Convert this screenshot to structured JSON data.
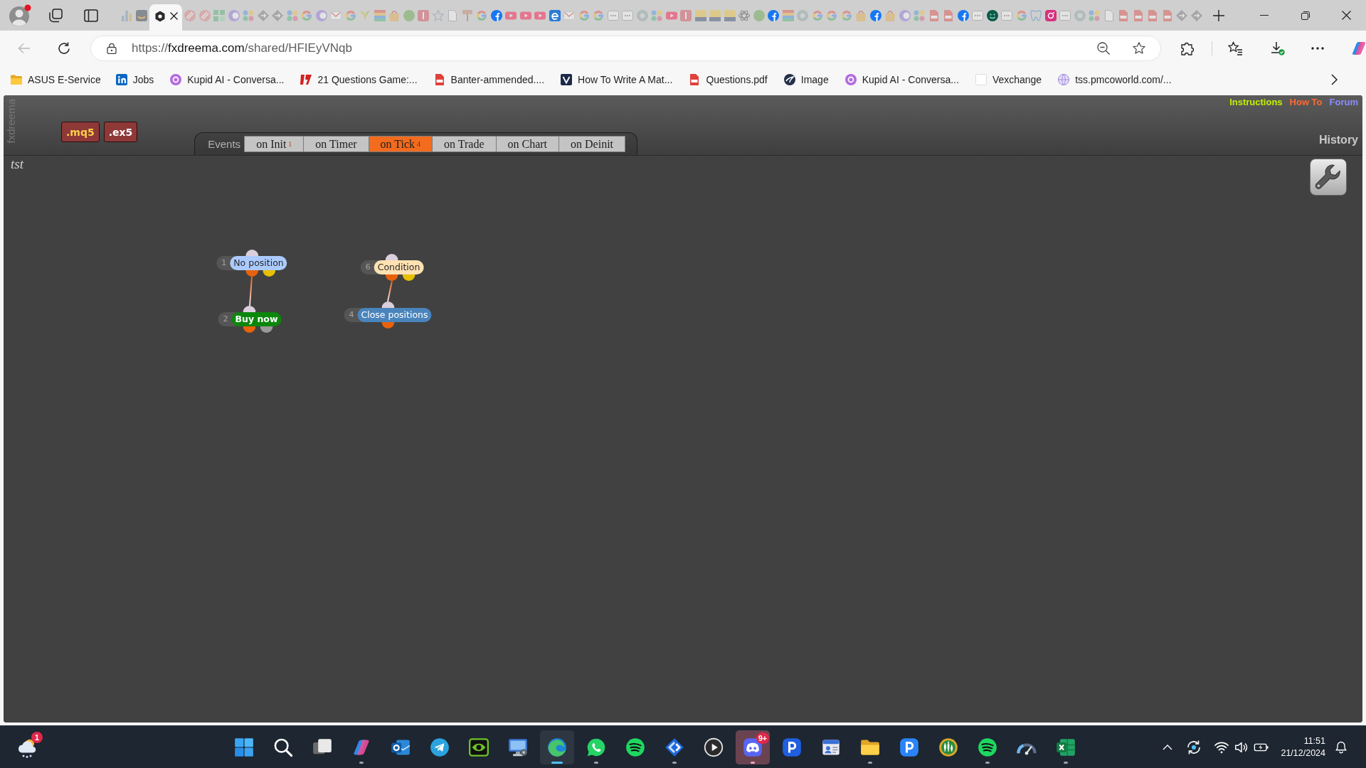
{
  "browser": {
    "tabs": [
      {
        "kind": "chart",
        "selected": false,
        "asleep": true
      },
      {
        "kind": "smile",
        "selected": false,
        "asleep": true
      },
      {
        "kind": "hexagon",
        "selected": true,
        "asleep": false
      },
      {
        "kind": "slash",
        "selected": false,
        "asleep": true
      },
      {
        "kind": "slash",
        "selected": false,
        "asleep": true
      },
      {
        "kind": "grid",
        "selected": false,
        "asleep": true
      },
      {
        "kind": "crescent",
        "selected": false,
        "asleep": true
      },
      {
        "kind": "dots",
        "selected": false,
        "asleep": true
      },
      {
        "kind": "diamond",
        "selected": false,
        "asleep": true
      },
      {
        "kind": "diamond",
        "selected": false,
        "asleep": true
      },
      {
        "kind": "dots",
        "selected": false,
        "asleep": true
      },
      {
        "kind": "ring",
        "selected": false,
        "asleep": true
      },
      {
        "kind": "crescent",
        "selected": false,
        "asleep": true
      },
      {
        "kind": "envelope",
        "selected": false,
        "asleep": true
      },
      {
        "kind": "ring",
        "selected": false,
        "asleep": true
      },
      {
        "kind": "leaf",
        "selected": false,
        "asleep": true
      },
      {
        "kind": "stripes",
        "selected": false,
        "asleep": true
      },
      {
        "kind": "bag",
        "selected": false,
        "asleep": true
      },
      {
        "kind": "disc",
        "selected": false,
        "asleep": true
      },
      {
        "kind": "tile",
        "selected": false,
        "asleep": true
      },
      {
        "kind": "star",
        "selected": false,
        "asleep": true
      },
      {
        "kind": "page",
        "selected": false,
        "asleep": true
      },
      {
        "kind": "sign",
        "selected": false,
        "asleep": true
      },
      {
        "kind": "ring",
        "selected": false,
        "asleep": true
      },
      {
        "kind": "fb",
        "selected": false,
        "asleep": false
      },
      {
        "kind": "play",
        "selected": false,
        "asleep": true
      },
      {
        "kind": "play",
        "selected": false,
        "asleep": true
      },
      {
        "kind": "play",
        "selected": false,
        "asleep": true
      },
      {
        "kind": "swirl",
        "selected": false,
        "asleep": false
      },
      {
        "kind": "envelope",
        "selected": false,
        "asleep": true
      },
      {
        "kind": "ring",
        "selected": false,
        "asleep": true
      },
      {
        "kind": "ring",
        "selected": false,
        "asleep": true
      },
      {
        "kind": "window",
        "selected": false,
        "asleep": true
      },
      {
        "kind": "window",
        "selected": false,
        "asleep": true
      },
      {
        "kind": "circle",
        "selected": false,
        "asleep": true
      },
      {
        "kind": "dots",
        "selected": false,
        "asleep": true
      },
      {
        "kind": "play",
        "selected": false,
        "asleep": true
      },
      {
        "kind": "tile",
        "selected": false,
        "asleep": true
      },
      {
        "kind": "crest",
        "selected": false,
        "asleep": true
      },
      {
        "kind": "crest",
        "selected": false,
        "asleep": true
      },
      {
        "kind": "crest",
        "selected": false,
        "asleep": true
      },
      {
        "kind": "knot",
        "selected": false,
        "asleep": true
      },
      {
        "kind": "disc",
        "selected": false,
        "asleep": true
      },
      {
        "kind": "fb",
        "selected": false,
        "asleep": false
      },
      {
        "kind": "stripes",
        "selected": false,
        "asleep": true
      },
      {
        "kind": "circle",
        "selected": false,
        "asleep": true
      },
      {
        "kind": "ring",
        "selected": false,
        "asleep": true
      },
      {
        "kind": "ring",
        "selected": false,
        "asleep": true
      },
      {
        "kind": "ring",
        "selected": false,
        "asleep": true
      },
      {
        "kind": "bag",
        "selected": false,
        "asleep": true
      },
      {
        "kind": "fb",
        "selected": false,
        "asleep": false
      },
      {
        "kind": "bag",
        "selected": false,
        "asleep": true
      },
      {
        "kind": "crescent",
        "selected": false,
        "asleep": true
      },
      {
        "kind": "dots",
        "selected": false,
        "asleep": true
      },
      {
        "kind": "pdf",
        "selected": false,
        "asleep": true
      },
      {
        "kind": "pdf",
        "selected": false,
        "asleep": true
      },
      {
        "kind": "fb",
        "selected": false,
        "asleep": false
      },
      {
        "kind": "window",
        "selected": false,
        "asleep": true
      },
      {
        "kind": "face",
        "selected": false,
        "asleep": false
      },
      {
        "kind": "window",
        "selected": false,
        "asleep": true
      },
      {
        "kind": "ring",
        "selected": false,
        "asleep": true
      },
      {
        "kind": "tooth",
        "selected": false,
        "asleep": true
      },
      {
        "kind": "camera",
        "selected": false,
        "asleep": false
      },
      {
        "kind": "window",
        "selected": false,
        "asleep": true
      },
      {
        "kind": "circle",
        "selected": false,
        "asleep": true
      },
      {
        "kind": "dots",
        "selected": false,
        "asleep": true
      },
      {
        "kind": "page",
        "selected": false,
        "asleep": true
      },
      {
        "kind": "pdf",
        "selected": false,
        "asleep": true
      },
      {
        "kind": "pdf",
        "selected": false,
        "asleep": true
      },
      {
        "kind": "pdf",
        "selected": false,
        "asleep": true
      },
      {
        "kind": "pdf",
        "selected": false,
        "asleep": true
      },
      {
        "kind": "diamond",
        "selected": false,
        "asleep": true
      },
      {
        "kind": "diamond",
        "selected": false,
        "asleep": true
      }
    ],
    "back_button": {
      "disabled": true
    },
    "address": {
      "scheme": "https://",
      "host": "fxdreema.com",
      "path": "/shared/HFIEyVNqb"
    },
    "bookmarks": [
      {
        "kind": "folder",
        "label": "ASUS E-Service"
      },
      {
        "kind": "blue_tile",
        "label": "Jobs"
      },
      {
        "kind": "purple_disc",
        "label": "Kupid AI - Conversa..."
      },
      {
        "kind": "red_mark",
        "label": "21 Questions Game:..."
      },
      {
        "kind": "pdf",
        "label": "Banter-ammended...."
      },
      {
        "kind": "dark_tile",
        "label": "How To Write A Mat..."
      },
      {
        "kind": "pdf",
        "label": "Questions.pdf"
      },
      {
        "kind": "dark_disc",
        "label": "Image"
      },
      {
        "kind": "purple_disc",
        "label": "Kupid AI - Conversa..."
      },
      {
        "kind": "blank",
        "label": "Vexchange"
      },
      {
        "kind": "globe",
        "label": "tss.pmcoworld.com/..."
      }
    ]
  },
  "app": {
    "side_label": "fxdreema",
    "exports": [
      {
        "label": ".mq5",
        "kind": "source"
      },
      {
        "label": ".ex5",
        "kind": "compiled"
      }
    ],
    "events_label": "Events",
    "event_tabs": [
      {
        "label": "on Init",
        "count": "1",
        "selected": false
      },
      {
        "label": "on Timer",
        "selected": false
      },
      {
        "label": "on Tick",
        "count": "4",
        "selected": true
      },
      {
        "label": "on Trade",
        "selected": false
      },
      {
        "label": "on Chart",
        "selected": false
      },
      {
        "label": "on Deinit",
        "selected": false
      }
    ],
    "links": [
      {
        "label": "Instructions",
        "color": "#c2f000"
      },
      {
        "label": "How To",
        "color": "#ff6a30"
      },
      {
        "label": "Forum",
        "color": "#8c8cff"
      }
    ],
    "history": "History",
    "project": "tst",
    "nodes": [
      {
        "number": "1",
        "label": "No position",
        "color": "#abcbff",
        "bold": false,
        "outputs": [
          {
            "color": "#e8610c",
            "children": [
              {
                "number": "2",
                "label": "Buy now",
                "color": "#0b870b",
                "bold": true,
                "outputs": [
                  {
                    "color": "#e8610c"
                  },
                  {
                    "color": "#9a9a9a"
                  }
                ]
              }
            ]
          },
          {
            "color": "#e6c000"
          }
        ]
      },
      {
        "number": "6",
        "label": "Condition",
        "color": "#ffe1b2",
        "bold": false,
        "outputs": [
          {
            "color": "#e8610c",
            "children": [
              {
                "number": "4",
                "label": "Close positions",
                "color": "#4a84bc",
                "bold": false,
                "outputs": [
                  {
                    "color": "#e8610c"
                  }
                ]
              }
            ]
          },
          {
            "color": "#e6c000"
          }
        ]
      }
    ]
  },
  "taskbar": {
    "weather_badge": "1",
    "apps": [
      {
        "kind": "start",
        "running": false,
        "selected": false,
        "flashing": false
      },
      {
        "kind": "search",
        "running": false,
        "selected": false,
        "flashing": false
      },
      {
        "kind": "taskview",
        "running": false,
        "selected": false,
        "flashing": false
      },
      {
        "kind": "copilot",
        "running": true,
        "selected": false,
        "flashing": false
      },
      {
        "kind": "outlook",
        "running": false,
        "selected": false,
        "flashing": false
      },
      {
        "kind": "telegram",
        "running": false,
        "selected": false,
        "flashing": false
      },
      {
        "kind": "eye",
        "running": false,
        "selected": false,
        "flashing": false
      },
      {
        "kind": "monitor",
        "running": false,
        "selected": false,
        "flashing": false
      },
      {
        "kind": "edge",
        "running": true,
        "selected": true,
        "flashing": false
      },
      {
        "kind": "whatsapp",
        "running": true,
        "selected": false,
        "flashing": false
      },
      {
        "kind": "spotify",
        "running": false,
        "selected": false,
        "flashing": false
      },
      {
        "kind": "diamond",
        "running": true,
        "selected": false,
        "flashing": false
      },
      {
        "kind": "media",
        "running": false,
        "selected": false,
        "flashing": false
      },
      {
        "kind": "discord",
        "running": true,
        "selected": false,
        "flashing": true,
        "badge": "9+"
      },
      {
        "kind": "p",
        "running": false,
        "selected": false,
        "flashing": false
      },
      {
        "kind": "contacts",
        "running": false,
        "selected": false,
        "flashing": false
      },
      {
        "kind": "folder",
        "running": true,
        "selected": false,
        "flashing": false
      },
      {
        "kind": "p2",
        "running": false,
        "selected": false,
        "flashing": false
      },
      {
        "kind": "candles",
        "running": false,
        "selected": false,
        "flashing": false
      },
      {
        "kind": "spotify",
        "running": true,
        "selected": false,
        "flashing": false
      },
      {
        "kind": "gauge",
        "running": false,
        "selected": false,
        "flashing": false
      },
      {
        "kind": "excel",
        "running": true,
        "selected": false,
        "flashing": false
      }
    ],
    "time": "11:51",
    "date": "21/12/2024"
  }
}
